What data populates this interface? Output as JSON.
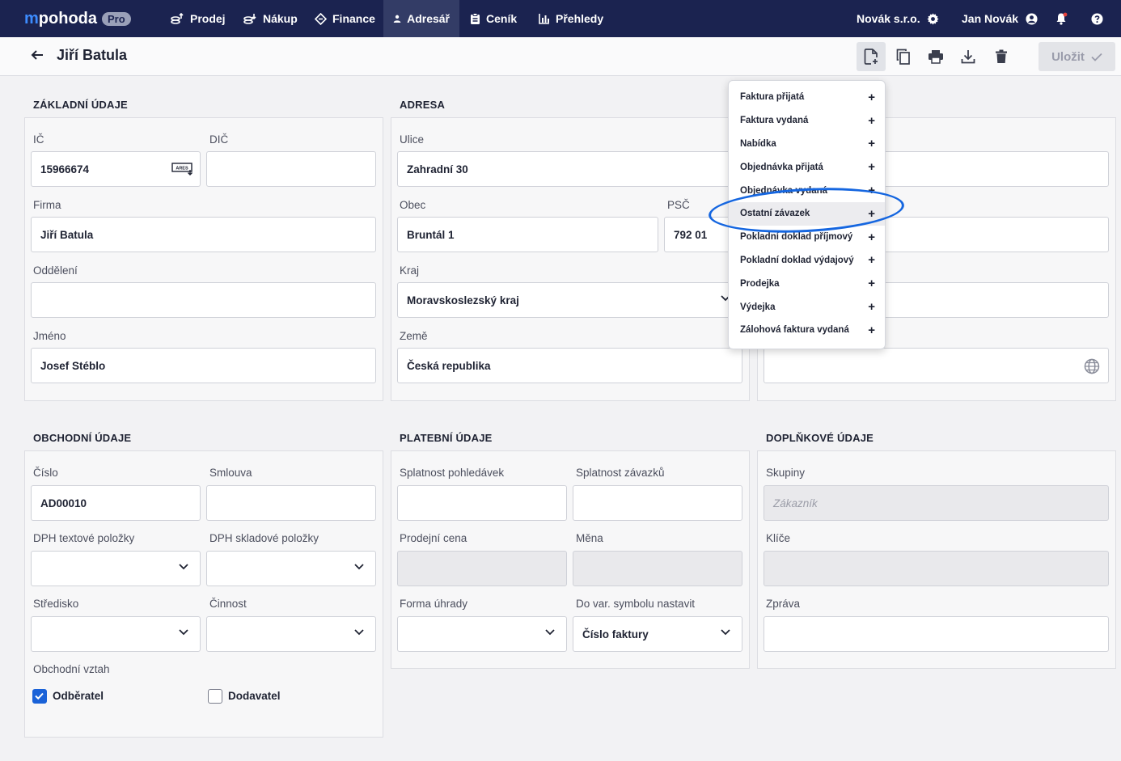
{
  "topbar": {
    "logo_prefix": "m",
    "logo_text": "pohoda",
    "logo_badge": "Pro",
    "nav": [
      {
        "label": "Prodej"
      },
      {
        "label": "Nákup"
      },
      {
        "label": "Finance"
      },
      {
        "label": "Adresář"
      },
      {
        "label": "Ceník"
      },
      {
        "label": "Přehledy"
      }
    ],
    "company": "Novák s.r.o.",
    "user": "Jan Novák"
  },
  "header": {
    "title": "Jiří Batula",
    "save_label": "Uložit"
  },
  "zakladni": {
    "title": "ZÁKLADNÍ ÚDAJE",
    "ic_label": "IČ",
    "ic_value": "15966674",
    "ares_badge": "ARES",
    "dic_label": "DIČ",
    "dic_value": "",
    "firma_label": "Firma",
    "firma_value": "Jiří Batula",
    "oddeleni_label": "Oddělení",
    "oddeleni_value": "",
    "jmeno_label": "Jméno",
    "jmeno_value": "Josef Stéblo"
  },
  "adresa": {
    "title": "ADRESA",
    "ulice_label": "Ulice",
    "ulice_value": "Zahradní 30",
    "obec_label": "Obec",
    "obec_value": "Bruntál 1",
    "psc_label": "PSČ",
    "psc_value": "792 01",
    "kraj_label": "Kraj",
    "kraj_value": "Moravskoslezský kraj",
    "zeme_label": "Země",
    "zeme_value": "Česká republika"
  },
  "obchodni": {
    "title": "OBCHODNÍ ÚDAJE",
    "cislo_label": "Číslo",
    "cislo_value": "AD00010",
    "smlouva_label": "Smlouva",
    "smlouva_value": "",
    "dph_text_label": "DPH textové položky",
    "dph_sklad_label": "DPH skladové položky",
    "stredisko_label": "Středisko",
    "cinnost_label": "Činnost",
    "vztah_label": "Obchodní vztah",
    "odberatel_label": "Odběratel",
    "odberatel_checked": true,
    "dodavatel_label": "Dodavatel",
    "dodavatel_checked": false
  },
  "platebni": {
    "title": "PLATEBNÍ ÚDAJE",
    "splat_pohl_label": "Splatnost pohledávek",
    "splat_zav_label": "Splatnost závazků",
    "prodejni_cena_label": "Prodejní cena",
    "mena_label": "Měna",
    "forma_label": "Forma úhrady",
    "varsym_label": "Do var. symbolu nastavit",
    "varsym_value": "Číslo faktury"
  },
  "doplnkove": {
    "title": "DOPLŇKOVÉ ÚDAJE",
    "skupiny_label": "Skupiny",
    "skupiny_value": "Zákazník",
    "klice_label": "Klíče",
    "zprava_label": "Zpráva"
  },
  "menu": {
    "items": [
      {
        "label": "Faktura přijatá"
      },
      {
        "label": "Faktura vydaná"
      },
      {
        "label": "Nabídka"
      },
      {
        "label": "Objednávka přijatá"
      },
      {
        "label": "Objednávka vydaná"
      },
      {
        "label": "Ostatní závazek"
      },
      {
        "label": "Pokladní doklad příjmový"
      },
      {
        "label": "Pokladní doklad výdajový"
      },
      {
        "label": "Prodejka"
      },
      {
        "label": "Výdejka"
      },
      {
        "label": "Zálohová faktura vydaná"
      }
    ],
    "highlighted_index": 5,
    "plus_symbol": "+"
  },
  "colors": {
    "topbar": "#1b2350",
    "accent": "#1a62d8",
    "annotation": "#1566e0"
  }
}
